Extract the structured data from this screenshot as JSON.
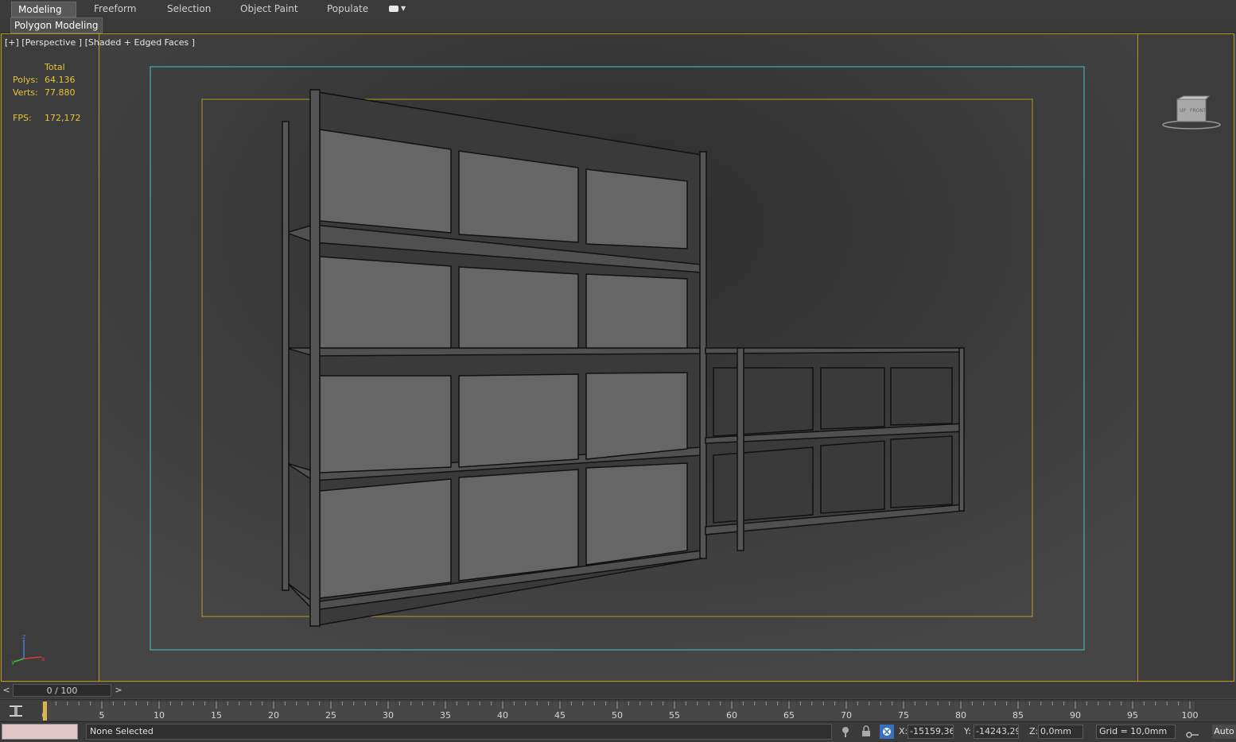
{
  "ribbon": {
    "tabs": [
      {
        "label": "Modeling",
        "active": true
      },
      {
        "label": "Freeform"
      },
      {
        "label": "Selection"
      },
      {
        "label": "Object Paint"
      },
      {
        "label": "Populate"
      }
    ],
    "sub_tab": "Polygon Modeling"
  },
  "viewport": {
    "label": "[+] [Perspective ] [Shaded + Edged Faces ]",
    "stats": {
      "header": "Total",
      "polys_label": "Polys:",
      "polys_value": "64.136",
      "verts_label": "Verts:",
      "verts_value": "77.880",
      "fps_label": "FPS:",
      "fps_value": "172,172"
    },
    "viewcube": {
      "top": "UP",
      "front": "FRONT"
    },
    "axis": {
      "x": "x",
      "y": "y",
      "z": "z"
    }
  },
  "timeline": {
    "frame_display": "0 / 100",
    "prev": "<",
    "next": ">",
    "ticks": [
      "0",
      "5",
      "10",
      "15",
      "20",
      "25",
      "30",
      "35",
      "40",
      "45",
      "50",
      "55",
      "60",
      "65",
      "70",
      "75",
      "80",
      "85",
      "90",
      "95",
      "100"
    ]
  },
  "status": {
    "selection": "None Selected",
    "x_label": "X:",
    "x_value": "-15159,36",
    "y_label": "Y:",
    "y_value": "-14243,29",
    "z_label": "Z:",
    "z_value": "0,0mm",
    "grid": "Grid = 10,0mm",
    "auto": "Auto"
  },
  "colors": {
    "frame_yellow": "#b59a1a",
    "safe_cyan": "#3ec6cc",
    "stat_yellow": "#e8c637"
  }
}
